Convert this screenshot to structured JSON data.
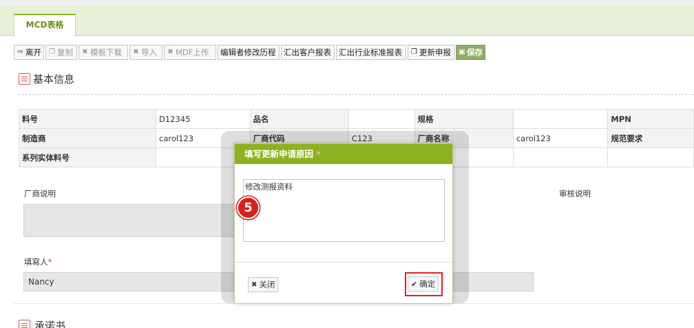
{
  "tab": {
    "label": "MCD表格"
  },
  "toolbar": {
    "buttons": [
      {
        "label": "离开",
        "icon": "exit-icon",
        "disabled": false
      },
      {
        "label": "复制",
        "icon": "copy-icon",
        "disabled": true
      },
      {
        "label": "模板下载",
        "icon": "excel-icon",
        "disabled": true
      },
      {
        "label": "导入",
        "icon": "excel-icon",
        "disabled": true
      },
      {
        "label": "MDF上传",
        "icon": "excel-icon",
        "disabled": true
      },
      {
        "label": "编辑者修改历程",
        "icon": "",
        "disabled": false
      },
      {
        "label": "汇出客户报表",
        "icon": "",
        "disabled": false
      },
      {
        "label": "汇出行业标准报表",
        "icon": "",
        "disabled": false
      },
      {
        "label": "更新申报",
        "icon": "copy-icon",
        "disabled": false
      },
      {
        "label": "保存",
        "icon": "save-icon",
        "disabled": false
      }
    ]
  },
  "section": {
    "title": "基本信息",
    "bottom_title": "承诺书"
  },
  "info_table": {
    "rows": [
      [
        "料号",
        "D12345",
        "品名",
        "",
        "规格",
        "",
        "MPN"
      ],
      [
        "制造商",
        "carol123",
        "厂商代码",
        "C123",
        "厂商名称",
        "carol123",
        "规范要求"
      ],
      [
        "系列实体料号",
        "",
        "",
        "",
        "",
        "",
        ""
      ]
    ]
  },
  "form": {
    "vendor_note_label": "厂商说明",
    "review_note_label": "审核说明",
    "filler_label": "填寫人",
    "filler_required": "*",
    "filler_value": "Nancy"
  },
  "modal": {
    "title": "填写更新申请原因",
    "required_mark": "*",
    "reason_value": "修改测报资料",
    "close_label": "关闭",
    "confirm_label": "确定"
  },
  "step_badge": "5",
  "colors": {
    "accent": "#8db21f",
    "highlight": "#dd2222"
  }
}
